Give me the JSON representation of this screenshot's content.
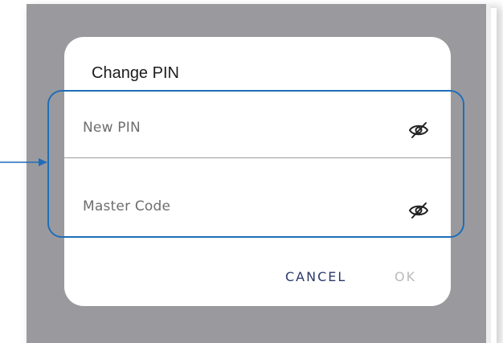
{
  "dialog": {
    "title": "Change PIN",
    "fields": [
      {
        "label": "New PIN",
        "icon": "eye-slash-icon"
      },
      {
        "label": "Master Code",
        "icon": "eye-slash-icon"
      }
    ],
    "actions": {
      "cancel_label": "CANCEL",
      "ok_label": "OK"
    }
  },
  "colors": {
    "overlay": "#9a9a9e",
    "highlight": "#1f6db8",
    "cancel_text": "#2c3a6b",
    "ok_text_disabled": "#b9b9b9"
  }
}
